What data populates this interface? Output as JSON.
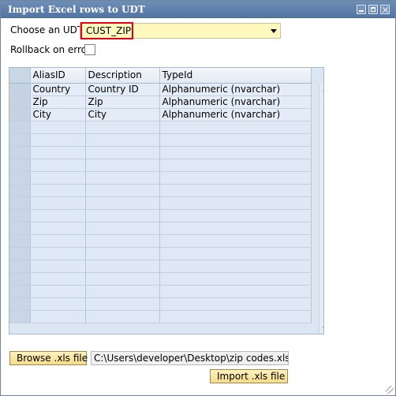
{
  "window": {
    "title": "Import Excel rows to UDT"
  },
  "form": {
    "udt_label": "Choose an UDT",
    "udt_selected": "CUST_ZIP",
    "rollback_label": "Rollback on erro",
    "rollback_checked": false
  },
  "grid": {
    "columns": [
      "AliasID",
      "Description",
      "TypeId"
    ],
    "rows": [
      [
        "Country",
        "Country ID",
        "Alphanumeric (nvarchar)"
      ],
      [
        "Zip",
        "Zip",
        "Alphanumeric (nvarchar)"
      ],
      [
        "City",
        "City",
        "Alphanumeric (nvarchar)"
      ]
    ]
  },
  "file": {
    "browse_label": "Browse .xls file",
    "path": "C:\\Users\\developer\\Desktop\\zip codes.xls",
    "import_label": "Import .xls file"
  },
  "colors": {
    "title_bar": "#5f80ad",
    "combo_background": "#fff9bd",
    "highlight_border": "#e0001a",
    "button_background": "#f8e6a8",
    "grid_background": "#dbe6f2"
  }
}
